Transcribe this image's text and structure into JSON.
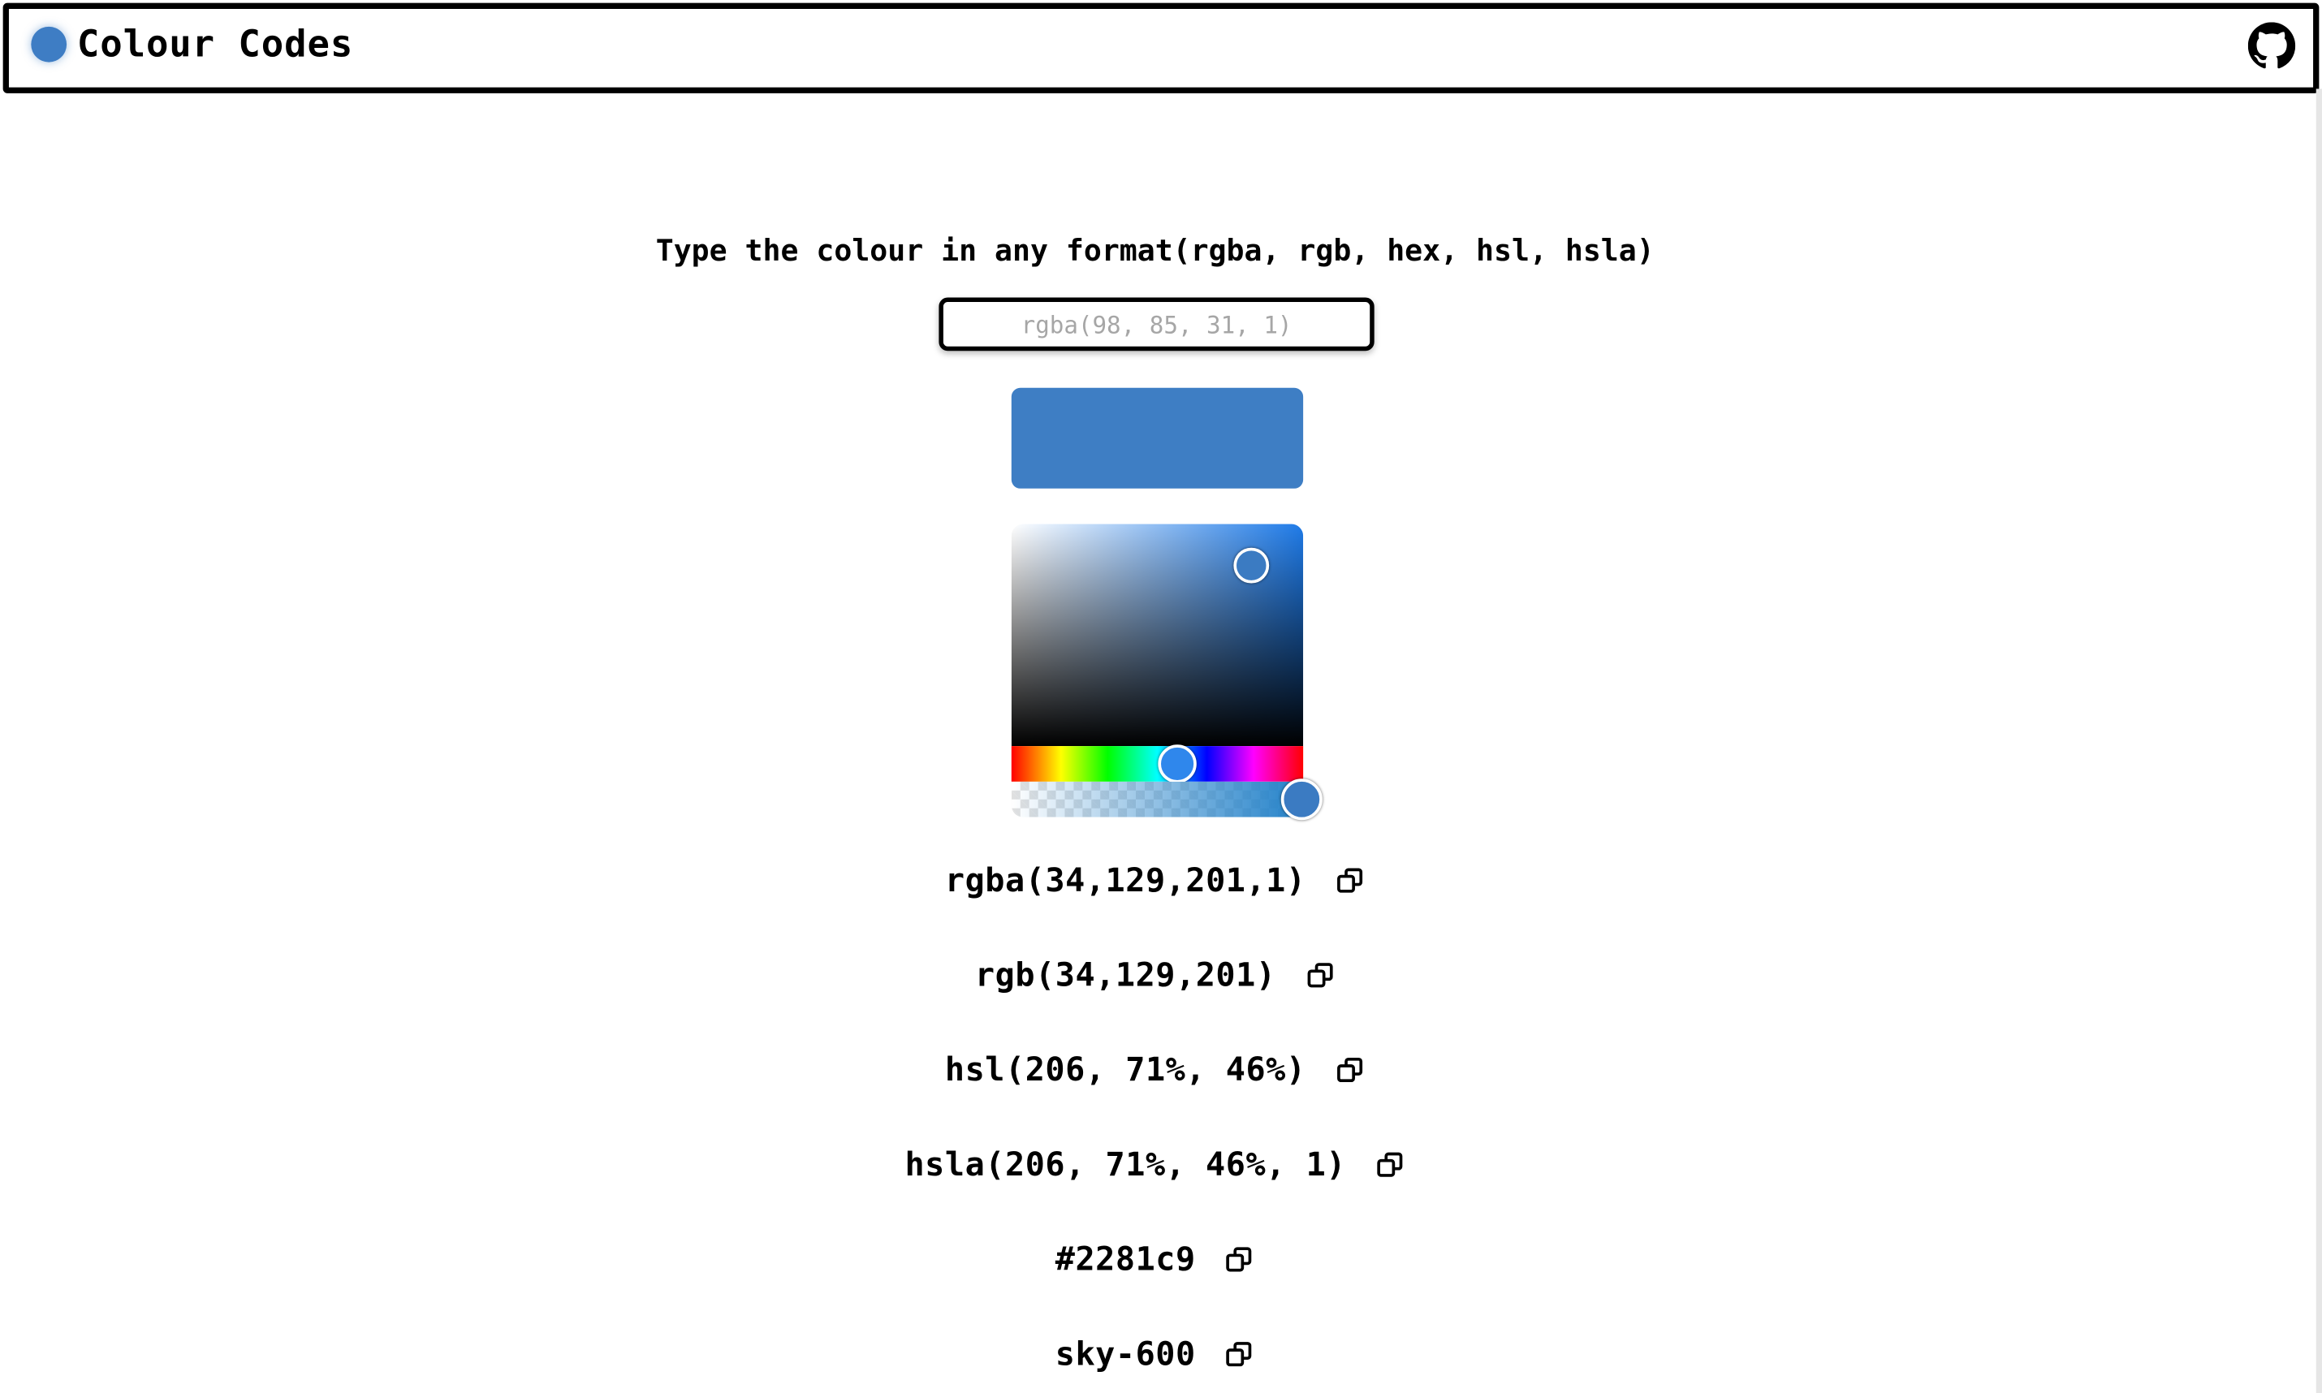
{
  "header": {
    "title": "Colour Codes",
    "logo_color": "#3e7dc4",
    "github_icon": "github-icon"
  },
  "main": {
    "prompt": "Type the colour in any format(rgba, rgb, hex, hsl, hsla)",
    "input": {
      "placeholder": "rgba(98, 85, 31, 1)",
      "value": ""
    },
    "swatch_color": "#3e7ec4",
    "picker": {
      "current_color": "#2281c9",
      "hue": 206,
      "alpha": 1
    },
    "codes": [
      {
        "label": "rgba(34,129,201,1)",
        "icon": "copy-icon"
      },
      {
        "label": "rgb(34,129,201)",
        "icon": "copy-icon"
      },
      {
        "label": "hsl(206, 71%, 46%)",
        "icon": "copy-icon"
      },
      {
        "label": "hsla(206, 71%, 46%, 1)",
        "icon": "copy-icon"
      },
      {
        "label": "#2281c9",
        "icon": "copy-icon"
      },
      {
        "label": "sky-600",
        "icon": "copy-icon"
      }
    ]
  }
}
